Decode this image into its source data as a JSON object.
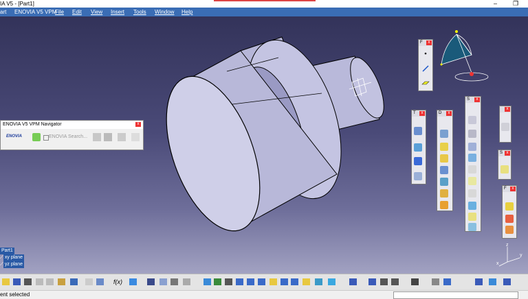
{
  "window": {
    "title": "IA V5 - [Part1]",
    "minimize": "–",
    "restore": "❐"
  },
  "menu": {
    "items": [
      "art",
      "ENOVIA V5 VPM",
      "File",
      "Edit",
      "View",
      "Insert",
      "Tools",
      "Window",
      "Help"
    ]
  },
  "panels": {
    "p1": {
      "title": "F"
    },
    "p2": {
      "title": "T"
    },
    "p3": {
      "title": "D"
    },
    "p4": {
      "title": "S"
    },
    "p5": {
      "title": ""
    },
    "p6": {
      "title": "S"
    },
    "p7": {
      "title": "F"
    }
  },
  "close_label": "x",
  "navigator": {
    "title": "ENOVIA V5 VPM Navigator",
    "search_label": "ENOVIA Search...",
    "logo_text": "ENOVIA"
  },
  "tree": {
    "root": "Part1",
    "items": [
      "xy plane",
      "yz plane"
    ]
  },
  "compass": {
    "axis_z": "z",
    "axis_y": "y",
    "axis_x": "x"
  },
  "toolbar": {
    "f_label": "f(x)"
  },
  "status": {
    "text": "ent selected"
  },
  "colors": {
    "background_top": "#33335a",
    "background_bottom": "#a2a2c2",
    "part_face": "#c8c8e4",
    "menu_bar": "#3a6db5",
    "close_red": "#e33"
  }
}
